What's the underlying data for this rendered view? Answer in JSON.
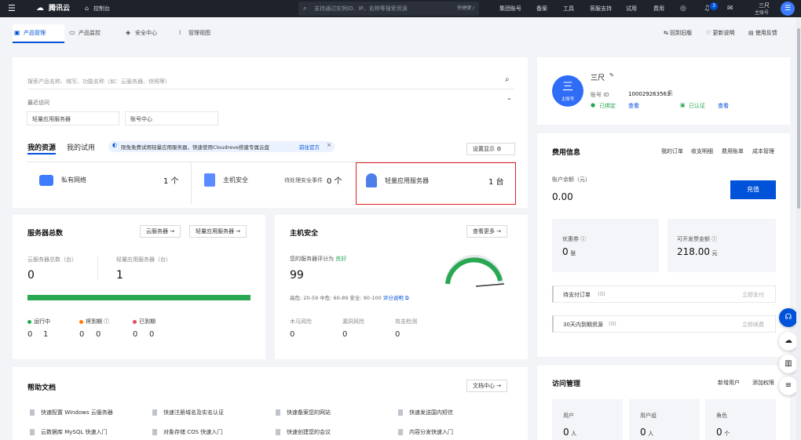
{
  "topbar": {
    "logo": "腾讯云",
    "console": "控制台",
    "search_placeholder": "支持通过实例ID、IP、名称等搜索资源",
    "shortcut": "快捷键 /",
    "nav": [
      "集团账号",
      "备案",
      "工具",
      "客服支持",
      "试用",
      "费用"
    ],
    "notify_count": "3",
    "user_name": "三尺",
    "user_sub": "主账号"
  },
  "tabs": [
    {
      "label": "产品管理",
      "icon": "grid-icon"
    },
    {
      "label": "产品监控",
      "icon": "monitor-icon"
    },
    {
      "label": "安全中心",
      "icon": "shield-icon"
    },
    {
      "label": "管理视图",
      "icon": "dots-icon"
    }
  ],
  "toplinks": [
    "回到旧版",
    "更新说明",
    "使用反馈"
  ],
  "search": {
    "placeholder": "搜索产品名称、缩写、功能名称（如：云服务器、快照等）",
    "recent_label": "最近访问",
    "recent": [
      "轻量应用服务器",
      "账号中心"
    ]
  },
  "resources": {
    "tab_active": "我的资源",
    "tab_other": "我的试用",
    "banner": "限免免费试用轻量应用服务器，快速使用Cloudreve搭建专属云盘",
    "banner_link": "前往官方",
    "settings": "设置显示",
    "items": [
      {
        "name": "私有网络",
        "count": "1 个",
        "extra": ""
      },
      {
        "name": "主机安全",
        "count": "0 个",
        "extra": "待处理安全事件"
      },
      {
        "name": "轻量应用服务器",
        "count": "1 台",
        "extra": ""
      }
    ]
  },
  "servers": {
    "title": "服务器总数",
    "btn_cvm": "云服务器 →",
    "btn_lh": "轻量应用服务器 →",
    "cvm_label": "云服务器总数（台）",
    "cvm_value": "0",
    "lh_label": "轻量应用服务器（台）",
    "lh_value": "1",
    "bar_fill": 1.0,
    "status": [
      {
        "label": "运行中",
        "color": "#29a852",
        "a": "0",
        "b": "1"
      },
      {
        "label": "将到期",
        "color": "#ff7d00",
        "a": "0",
        "b": "0"
      },
      {
        "label": "已到期",
        "color": "#e34d59",
        "a": "0",
        "b": "0"
      }
    ]
  },
  "host_security": {
    "title": "主机安全",
    "more": "查看更多 →",
    "score_label": "您的服务器评分为",
    "score_grade": "良好",
    "score": "99",
    "legend": "高危: 20-59  中危: 60-89  安全: 90-100",
    "legend_link": "评分说明",
    "metrics": [
      {
        "label": "木马风险",
        "value": "0"
      },
      {
        "label": "漏洞风险",
        "value": "0"
      },
      {
        "label": "攻击检测",
        "value": "0"
      }
    ]
  },
  "help": {
    "title": "帮助文档",
    "center": "文档中心 →",
    "docs": [
      "快速配置 Windows 云服务器",
      "快速注册域名及实名认证",
      "快速备案您的网站",
      "快速发送国内短信",
      "云数据库 MySQL 快速入门",
      "对象存储 COS 快速入门",
      "快速创建您的会议",
      "内容分发快速入门"
    ]
  },
  "account": {
    "avatar_text": "三",
    "avatar_sub": "主账号",
    "name": "三尺",
    "id_label": "账号 ID",
    "id_value": "100029263563",
    "wechat": "已绑定",
    "view1": "查看",
    "verified": "已认证",
    "view2": "查看"
  },
  "billing": {
    "title": "费用信息",
    "links": [
      "我的订单",
      "收支明细",
      "费用账单",
      "成本管理"
    ],
    "balance_label": "账户余额（元）",
    "balance": "0.00",
    "recharge": "充值",
    "coupon_label": "优惠券",
    "coupon_value": "0",
    "coupon_unit": "张",
    "invoice_label": "可开发票金额",
    "invoice_value": "218.00",
    "invoice_unit": "元",
    "pending_label": "待支付订单",
    "pending_count": "(0)",
    "pending_action": "立即支付",
    "expire_label": "30天内到期资源",
    "expire_count": "(0)",
    "expire_action": "立即续费"
  },
  "access": {
    "title": "访问管理",
    "links": [
      "新增用户",
      "添加权限"
    ],
    "boxes": [
      {
        "label": "用户",
        "value": "0",
        "unit": "人"
      },
      {
        "label": "用户组",
        "value": "0",
        "unit": "人"
      },
      {
        "label": "角色",
        "value": "0",
        "unit": "个"
      }
    ]
  },
  "colors": {
    "accent": "#0052d9",
    "green": "#29a852",
    "topbar": "#1e222b"
  }
}
